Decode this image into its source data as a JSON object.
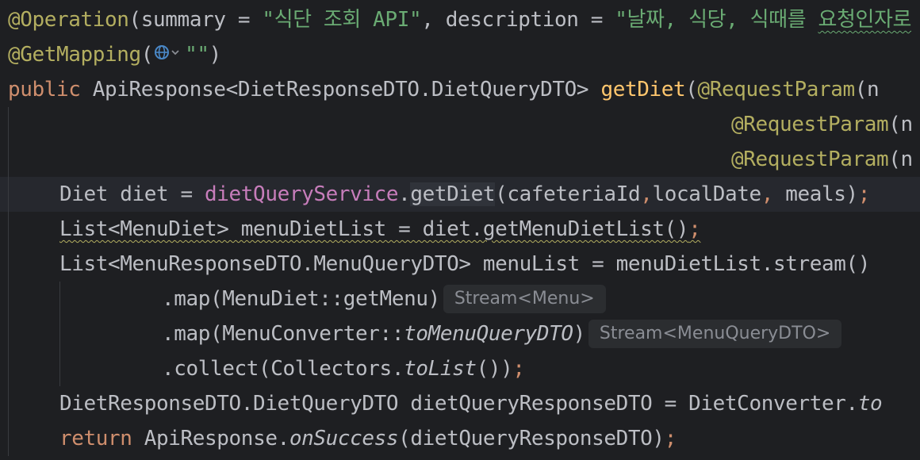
{
  "lines": {
    "l1": {
      "annotation": "@Operation",
      "p1": "(summary = ",
      "str1": "\"식단 조회 API\"",
      "p2": ", description = ",
      "str2": "\"날짜, 식당, 식때를 ",
      "str3": "요청인자로"
    },
    "l2": {
      "annotation": "@GetMapping",
      "p1": "(",
      "str": "\"\"",
      "p2": ")"
    },
    "l3": {
      "kw": "public",
      "type": " ApiResponse<DietResponseDTO.DietQueryDTO> ",
      "method": "getDiet",
      "p1": "(",
      "annotation": "@RequestParam",
      "p2": "(n"
    },
    "l4": {
      "annotation": "@RequestParam",
      "p": "(n"
    },
    "l5": {
      "annotation": "@RequestParam",
      "p": "(n"
    },
    "l6": {
      "p1": "Diet diet = ",
      "field": "dietQueryService",
      "p2": ".",
      "call": "getDiet",
      "p3": "(cafeteriaId",
      "comma1": ",",
      "p4": "localDate",
      "comma2": ",",
      "p5": " meals)",
      "semi": ";"
    },
    "l7": {
      "underlined": "List<MenuDiet> menuDietList = diet.getMenuDietList()",
      "semi": ";"
    },
    "l8": {
      "p": "List<MenuResponseDTO.MenuQueryDTO> menuList = menuDietList.stream()"
    },
    "l9": {
      "p": ".map(MenuDiet::getMenu)",
      "hint": "Stream<Menu>"
    },
    "l10": {
      "p1": ".map(MenuConverter::",
      "italic": "toMenuQueryDTO",
      "p2": ")",
      "hint": "Stream<MenuQueryDTO>"
    },
    "l11": {
      "p1": ".collect(Collectors.",
      "italic": "toList",
      "p2": "())",
      "semi": ";"
    },
    "l12": {
      "p": "DietResponseDTO.DietQueryDTO dietQueryResponseDTO = DietConverter.",
      "italic": "to"
    },
    "l13": {
      "kw": "return",
      "p1": " ApiResponse.",
      "italic": "onSuccess",
      "p2": "(dietQueryResponseDTO)",
      "semi": ";"
    }
  },
  "icons": {
    "mapping_chip": "globe-icon",
    "chip_chevron": "chevron-down-icon"
  },
  "colors": {
    "background": "#1e1f22",
    "keyword": "#cf8e6d",
    "annotation": "#b3ae60",
    "string": "#6aab73",
    "field": "#c77dbb",
    "method_decl": "#ffc66d",
    "text": "#bcbec4"
  }
}
